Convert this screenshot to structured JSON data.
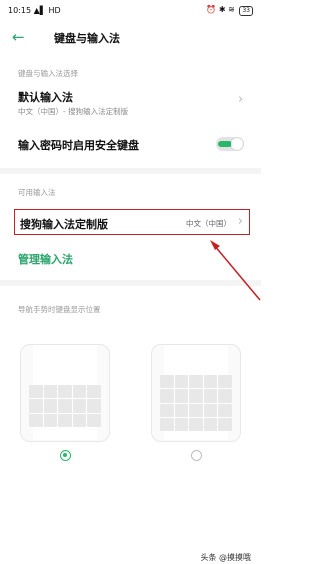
{
  "status": {
    "time": "10:15",
    "network": "HD",
    "battery": "33"
  },
  "header": {
    "title": "键盘与输入法"
  },
  "sections": {
    "keyboard_section_label": "键盘与输入法选择",
    "default_input": {
      "title": "默认输入法",
      "subtitle": "中文（中国）- 搜狗输入法定制版"
    },
    "secure_keyboard": {
      "title": "输入密码时启用安全键盘",
      "enabled": true
    },
    "available_label": "可用输入法",
    "sogou": {
      "title": "搜狗输入法定制版",
      "value": "中文（中国）"
    },
    "manage": "管理输入法",
    "position_label": "导航手势时键盘显示位置",
    "position_options": [
      {
        "name": "top-keyboard",
        "selected": true
      },
      {
        "name": "lower-keyboard",
        "selected": false
      }
    ]
  },
  "watermark": "头条 @摸摸哦",
  "colors": {
    "accent": "#29b86b",
    "highlight_box": "#c61f24",
    "arrow": "#c61f24"
  }
}
